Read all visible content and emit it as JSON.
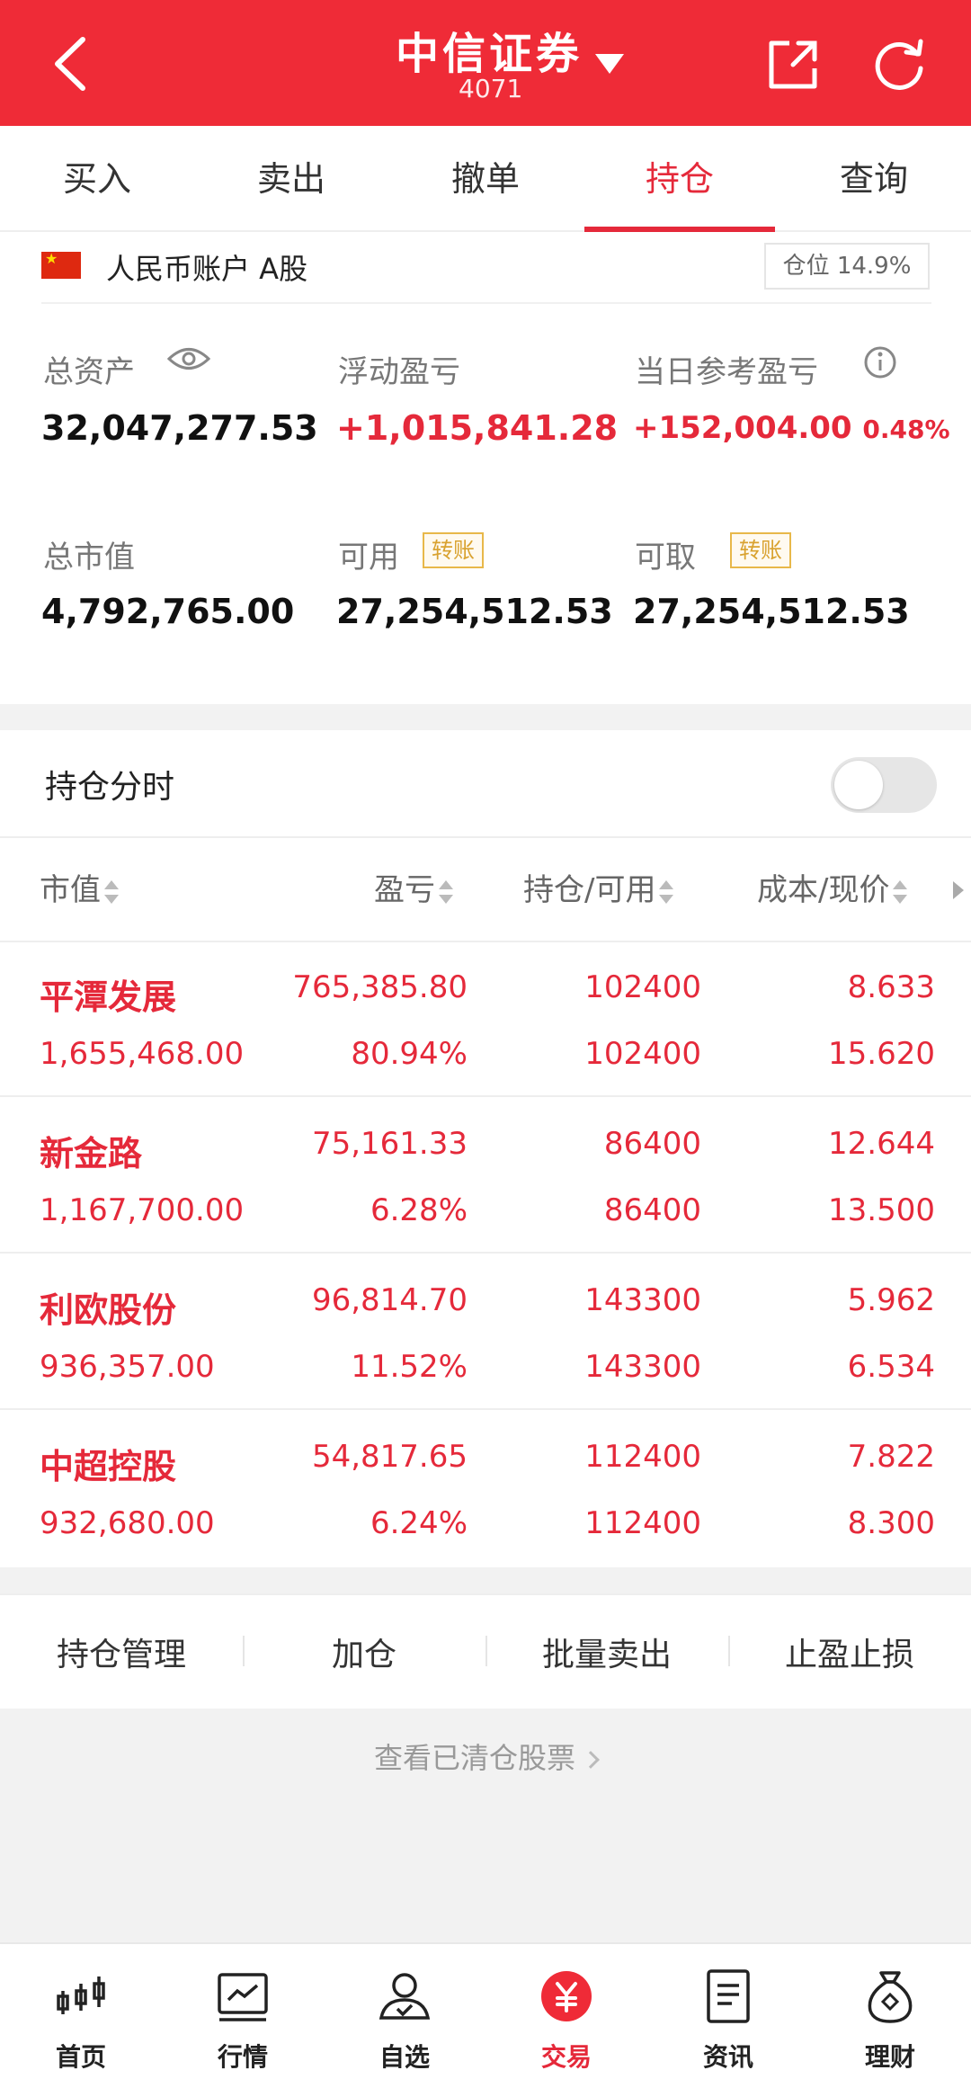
{
  "header": {
    "title": "中信证券",
    "subtitle": "4071"
  },
  "tabs": [
    "买入",
    "卖出",
    "撤单",
    "持仓",
    "查询"
  ],
  "account": {
    "label": "人民币账户 A股",
    "position_badge": "仓位 14.9%"
  },
  "stats": {
    "total_assets": {
      "label": "总资产",
      "value": "32,047,277.53"
    },
    "floating_pl": {
      "label": "浮动盈亏",
      "value": "+1,015,841.28"
    },
    "daily_pl": {
      "label": "当日参考盈亏",
      "value": "+152,004.00",
      "pct": "0.48%"
    },
    "market_value": {
      "label": "总市值",
      "value": "4,792,765.00"
    },
    "available": {
      "label": "可用",
      "tag": "转账",
      "value": "27,254,512.53"
    },
    "withdrawable": {
      "label": "可取",
      "tag": "转账",
      "value": "27,254,512.53"
    }
  },
  "holdings_section": {
    "toggle_label": "持仓分时",
    "columns": [
      "市值",
      "盈亏",
      "持仓/可用",
      "成本/现价"
    ],
    "rows": [
      {
        "name": "平潭发展",
        "mv": "1,655,468.00",
        "pl": "765,385.80",
        "pl_pct": "80.94%",
        "hold": "102400",
        "avail": "102400",
        "cost": "8.633",
        "price": "15.620"
      },
      {
        "name": "新金路",
        "mv": "1,167,700.00",
        "pl": "75,161.33",
        "pl_pct": "6.28%",
        "hold": "86400",
        "avail": "86400",
        "cost": "12.644",
        "price": "13.500"
      },
      {
        "name": "利欧股份",
        "mv": "936,357.00",
        "pl": "96,814.70",
        "pl_pct": "11.52%",
        "hold": "143300",
        "avail": "143300",
        "cost": "5.962",
        "price": "6.534"
      },
      {
        "name": "中超控股",
        "mv": "932,680.00",
        "pl": "54,817.65",
        "pl_pct": "6.24%",
        "hold": "112400",
        "avail": "112400",
        "cost": "7.822",
        "price": "8.300"
      }
    ],
    "actions": [
      "持仓管理",
      "加仓",
      "批量卖出",
      "止盈止损"
    ]
  },
  "cleared_link": "查看已清仓股票",
  "bottom_nav": [
    {
      "label": "首页",
      "icon": "candlestick-icon"
    },
    {
      "label": "行情",
      "icon": "chart-line-icon"
    },
    {
      "label": "自选",
      "icon": "user-icon"
    },
    {
      "label": "交易",
      "icon": "yuan-icon"
    },
    {
      "label": "资讯",
      "icon": "document-icon"
    },
    {
      "label": "理财",
      "icon": "money-bag-icon"
    }
  ],
  "colors": {
    "brand": "#ef2b37",
    "gain": "#e5293a",
    "tag": "#e8b84a"
  }
}
